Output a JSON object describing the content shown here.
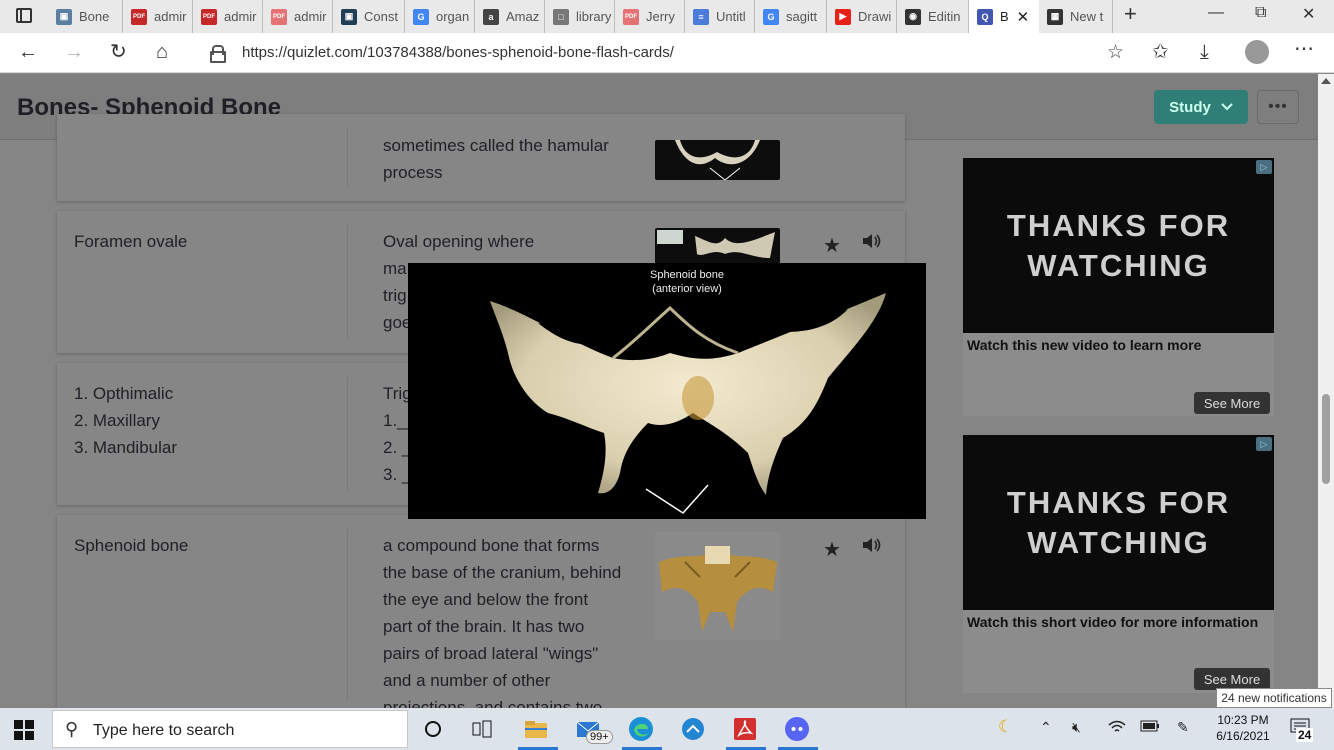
{
  "browser": {
    "tabs": [
      {
        "label": "Bone",
        "icon": "generic-icon",
        "color": "#5a7fa0"
      },
      {
        "label": "admir",
        "icon": "pdf-icon",
        "color": "#c62828"
      },
      {
        "label": "admir",
        "icon": "pdf-icon",
        "color": "#c62828"
      },
      {
        "label": "admir",
        "icon": "pdf-icon",
        "color": "#e57373"
      },
      {
        "label": "Const",
        "icon": "book-icon",
        "color": "#1f3f57"
      },
      {
        "label": "organ",
        "icon": "google-icon",
        "color": "#4285f4"
      },
      {
        "label": "Amaz",
        "icon": "amazon-icon",
        "color": "#444444"
      },
      {
        "label": "library",
        "icon": "document-icon",
        "color": "#777777"
      },
      {
        "label": "Jerry",
        "icon": "pdf-icon",
        "color": "#e57373"
      },
      {
        "label": "Untitl",
        "icon": "docs-icon",
        "color": "#4c7bd9"
      },
      {
        "label": "sagitt",
        "icon": "google-icon",
        "color": "#4285f4"
      },
      {
        "label": "Drawi",
        "icon": "youtube-icon",
        "color": "#e62117"
      },
      {
        "label": "Editin",
        "icon": "github-icon",
        "color": "#333333"
      },
      {
        "label": "B",
        "icon": "quizlet-icon",
        "color": "#4257b2",
        "active": true
      },
      {
        "label": "New t",
        "icon": "newtab-icon",
        "color": "#333333"
      }
    ],
    "url": "https://quizlet.com/103784388/bones-sphenoid-bone-flash-cards/"
  },
  "page": {
    "title": "Bones- Sphenoid Bone",
    "study_label": "Study",
    "more_label": "•••"
  },
  "cards": [
    {
      "term": "",
      "definition_lines": [
        "sometimes called the hamular",
        "process"
      ]
    },
    {
      "term": "Foramen ovale",
      "definition_lines": [
        "Oval opening where",
        "ma",
        "trig",
        "goe"
      ]
    },
    {
      "term_lines": [
        "1. Opthimalic",
        "2. Maxillary",
        "3. Mandibular"
      ],
      "definition_lines": [
        "Trig",
        "1.__",
        "2. _",
        "3. _"
      ]
    },
    {
      "term": "Sphenoid bone",
      "definition_lines": [
        "a compound bone that forms",
        "the base of the cranium, behind",
        "the eye and below the front",
        "part of the brain. It has two",
        "pairs of broad lateral \"wings\"",
        "and a number of other",
        "projections, and contains two"
      ]
    }
  ],
  "popup": {
    "caption_line1": "Sphenoid bone",
    "caption_line2": "(anterior view)"
  },
  "ads": [
    {
      "headline_1": "THANKS FOR",
      "headline_2": "WATCHING",
      "caption": "Watch this new video to learn more",
      "button": "See More"
    },
    {
      "headline_1": "THANKS FOR",
      "headline_2": "WATCHING",
      "caption": "Watch this short video for more information",
      "button": "See More"
    }
  ],
  "taskbar": {
    "search_placeholder": "Type here to search",
    "mail_badge": "99+",
    "time": "10:23 PM",
    "date": "6/16/2021",
    "notification_count": "24",
    "notification_tooltip": "24 new notifications"
  }
}
